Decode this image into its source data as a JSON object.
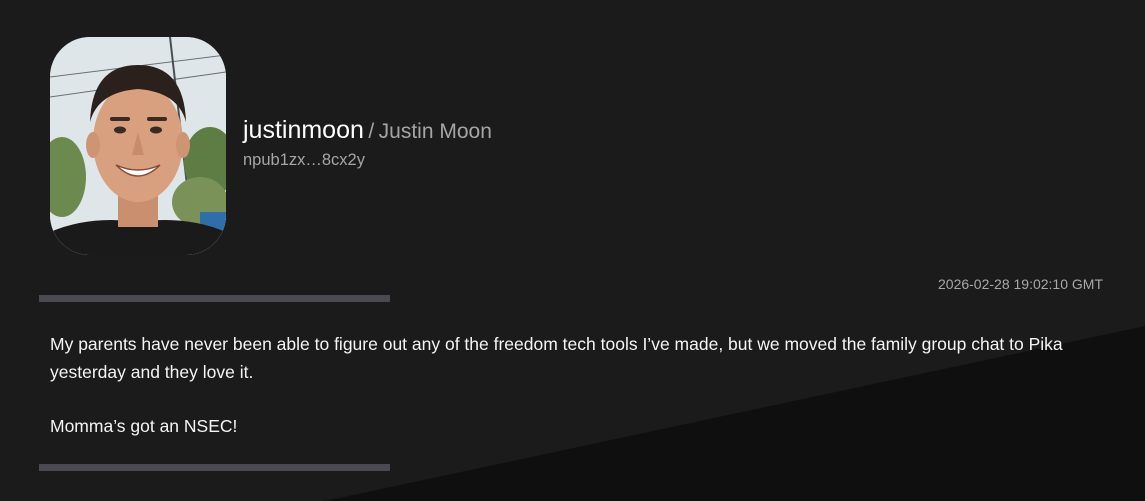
{
  "profile": {
    "username": "justinmoon",
    "separator": "/",
    "display_name": "Justin Moon",
    "npub_short": "npub1zx…8cx2y"
  },
  "note": {
    "timestamp": "2026-02-28 19:02:10 GMT",
    "paragraphs": [
      "My parents have never been able to figure out any of the freedom tech tools I’ve made, but we moved the family group chat to Pika yesterday and they love it.",
      "Momma’s got an NSEC!"
    ]
  },
  "colors": {
    "background": "#1b1b1c",
    "wedge": "#0f0f10",
    "divider": "#4a4a50",
    "muted_text": "#a5a5a5"
  },
  "icons": {
    "avatar": "profile-photo"
  }
}
